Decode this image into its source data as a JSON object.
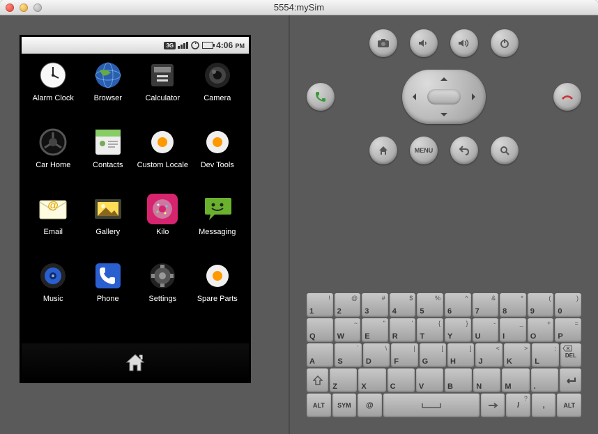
{
  "window": {
    "title": "5554:mySim"
  },
  "statusbar": {
    "threeg": "3G",
    "time": "4:06",
    "ampm": "PM"
  },
  "apps": [
    {
      "name": "Alarm Clock",
      "icon": "clock"
    },
    {
      "name": "Browser",
      "icon": "globe"
    },
    {
      "name": "Calculator",
      "icon": "calc"
    },
    {
      "name": "Camera",
      "icon": "camera"
    },
    {
      "name": "Car Home",
      "icon": "steering"
    },
    {
      "name": "Contacts",
      "icon": "contacts"
    },
    {
      "name": "Custom Locale",
      "icon": "gear-orange"
    },
    {
      "name": "Dev Tools",
      "icon": "gear-orange"
    },
    {
      "name": "Email",
      "icon": "email"
    },
    {
      "name": "Gallery",
      "icon": "gallery"
    },
    {
      "name": "Kilo",
      "icon": "donut"
    },
    {
      "name": "Messaging",
      "icon": "messaging"
    },
    {
      "name": "Music",
      "icon": "music"
    },
    {
      "name": "Phone",
      "icon": "phone"
    },
    {
      "name": "Settings",
      "icon": "settings"
    },
    {
      "name": "Spare Parts",
      "icon": "gear-orange"
    }
  ],
  "hw": {
    "menu_label": "MENU"
  },
  "keys": {
    "r1": [
      {
        "m": "1",
        "a": "!"
      },
      {
        "m": "2",
        "a": "@"
      },
      {
        "m": "3",
        "a": "#"
      },
      {
        "m": "4",
        "a": "$"
      },
      {
        "m": "5",
        "a": "%"
      },
      {
        "m": "6",
        "a": "^"
      },
      {
        "m": "7",
        "a": "&"
      },
      {
        "m": "8",
        "a": "*"
      },
      {
        "m": "9",
        "a": "("
      },
      {
        "m": "0",
        "a": ")"
      }
    ],
    "r2": [
      {
        "m": "Q",
        "a": ""
      },
      {
        "m": "W",
        "a": "~"
      },
      {
        "m": "E",
        "a": "\""
      },
      {
        "m": "R",
        "a": "'"
      },
      {
        "m": "T",
        "a": "{"
      },
      {
        "m": "Y",
        "a": "}"
      },
      {
        "m": "U",
        "a": "-"
      },
      {
        "m": "I",
        "a": "_"
      },
      {
        "m": "O",
        "a": "+"
      },
      {
        "m": "P",
        "a": "="
      }
    ],
    "r3": [
      {
        "m": "A",
        "a": ""
      },
      {
        "m": "S",
        "a": "`"
      },
      {
        "m": "D",
        "a": "\\"
      },
      {
        "m": "F",
        "a": "|"
      },
      {
        "m": "G",
        "a": "["
      },
      {
        "m": "H",
        "a": "]"
      },
      {
        "m": "J",
        "a": "<"
      },
      {
        "m": "K",
        "a": ">"
      },
      {
        "m": "L",
        "a": ";"
      }
    ],
    "r4": [
      {
        "m": "Z",
        "a": ""
      },
      {
        "m": "X",
        "a": ""
      },
      {
        "m": "C",
        "a": ""
      },
      {
        "m": "V",
        "a": ""
      },
      {
        "m": "B",
        "a": ""
      },
      {
        "m": "N",
        "a": ""
      },
      {
        "m": "M",
        "a": ""
      },
      {
        "m": ".",
        "a": ""
      }
    ],
    "del": "DEL",
    "alt": "ALT",
    "sym": "SYM",
    "at": "@",
    "arrow": "→",
    "slash": "/",
    "comma": ",",
    "alt2": "ALT"
  }
}
